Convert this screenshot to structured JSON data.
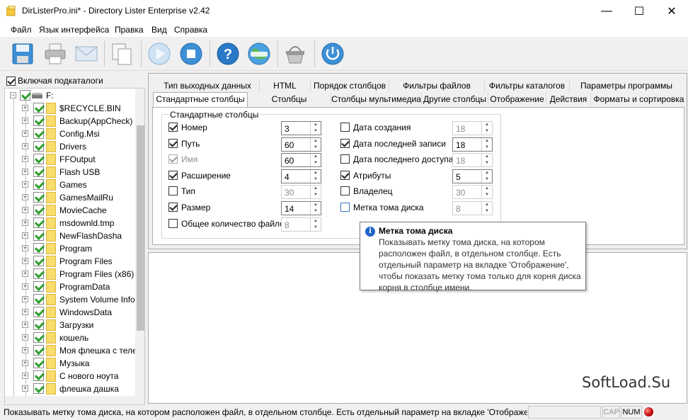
{
  "window": {
    "title": "DirListerPro.ini* - Directory Lister Enterprise v2.42",
    "minimize_glyph": "—",
    "maximize_glyph": "☐",
    "close_glyph": "✕"
  },
  "menu": [
    "Файл",
    "Язык интерфейса",
    "Правка",
    "Вид",
    "Справка"
  ],
  "toolbar": {
    "icons": [
      "save-icon",
      "print-icon",
      "email-icon",
      "copy-icon",
      "play-icon",
      "stop-icon",
      "help-icon",
      "www-icon",
      "basket-icon",
      "power-icon"
    ]
  },
  "tree": {
    "include_subfolders_label": "Включая подкаталоги",
    "drive_label": "F:",
    "folders": [
      "$RECYCLE.BIN",
      "Backup(AppCheck)",
      "Config.Msi",
      "Drivers",
      "FFOutput",
      "Flash USB",
      "Games",
      "GamesMailRu",
      "MovieCache",
      "msdownld.tmp",
      "NewFlashDasha",
      "Program",
      "Program Files",
      "Program Files (x86)",
      "ProgramData",
      "System Volume Inform",
      "WindowsData",
      "Загрузки",
      "кошель",
      "Моя флешка с телеф",
      "Музыка",
      "С нового ноута",
      "флешка дашка"
    ]
  },
  "tabs": {
    "row1": [
      "Тип выходных данных",
      "HTML",
      "Порядок столбцов",
      "Фильтры файлов",
      "Фильтры каталогов",
      "Параметры программы"
    ],
    "row2": [
      "Стандартные столбцы",
      "Столбцы документов",
      "Столбцы мультимедиа",
      "Другие столбцы",
      "Отображение",
      "Действия",
      "Форматы и сортировка"
    ]
  },
  "standard_columns": {
    "group_title": "Стандартные столбцы",
    "left": [
      {
        "label": "Номер",
        "checked": true,
        "value": "3",
        "enabled": true
      },
      {
        "label": "Путь",
        "checked": true,
        "value": "60",
        "enabled": true
      },
      {
        "label": "Имя",
        "checked": true,
        "value": "60",
        "enabled": true,
        "dim": true
      },
      {
        "label": "Расширение",
        "checked": true,
        "value": "4",
        "enabled": true
      },
      {
        "label": "Тип",
        "checked": false,
        "value": "30",
        "enabled": false
      },
      {
        "label": "Размер",
        "checked": true,
        "value": "14",
        "enabled": true
      },
      {
        "label": "Общее количество файлов",
        "checked": false,
        "value": "8",
        "enabled": false
      }
    ],
    "right": [
      {
        "label": "Дата создания",
        "checked": false,
        "value": "18",
        "enabled": false
      },
      {
        "label": "Дата последней записи",
        "checked": true,
        "value": "18",
        "enabled": true
      },
      {
        "label": "Дата последнего доступа",
        "checked": false,
        "value": "18",
        "enabled": false
      },
      {
        "label": "Атрибуты",
        "checked": true,
        "value": "5",
        "enabled": true
      },
      {
        "label": "Владелец",
        "checked": false,
        "value": "30",
        "enabled": false
      },
      {
        "label": "Метка тома диска",
        "checked": false,
        "value": "8",
        "enabled": false,
        "hover": true
      }
    ]
  },
  "tooltip": {
    "icon": "i",
    "title": "Метка тома диска",
    "lines": [
      "Показывать метку тома диска, на котором",
      "расположен файл, в отдельном столбце. Есть",
      "отдельный параметр на вкладке  'Отображение',",
      "чтобы показать  метку тома только для корня диска",
      "корня в столбце имени."
    ]
  },
  "watermark": "SoftLoad.Su",
  "statusbar": {
    "text": "Показывать метку тома диска, на котором расположен файл, в отдельном столбце. Есть отдельный параметр на вкладке  'Отображение",
    "cap": "CAP",
    "num": "NUM"
  },
  "colors": {
    "accent": "#1f63c6",
    "check_green": "#2ea02e",
    "folder": "#f8dc6c",
    "led": "#c00000"
  }
}
